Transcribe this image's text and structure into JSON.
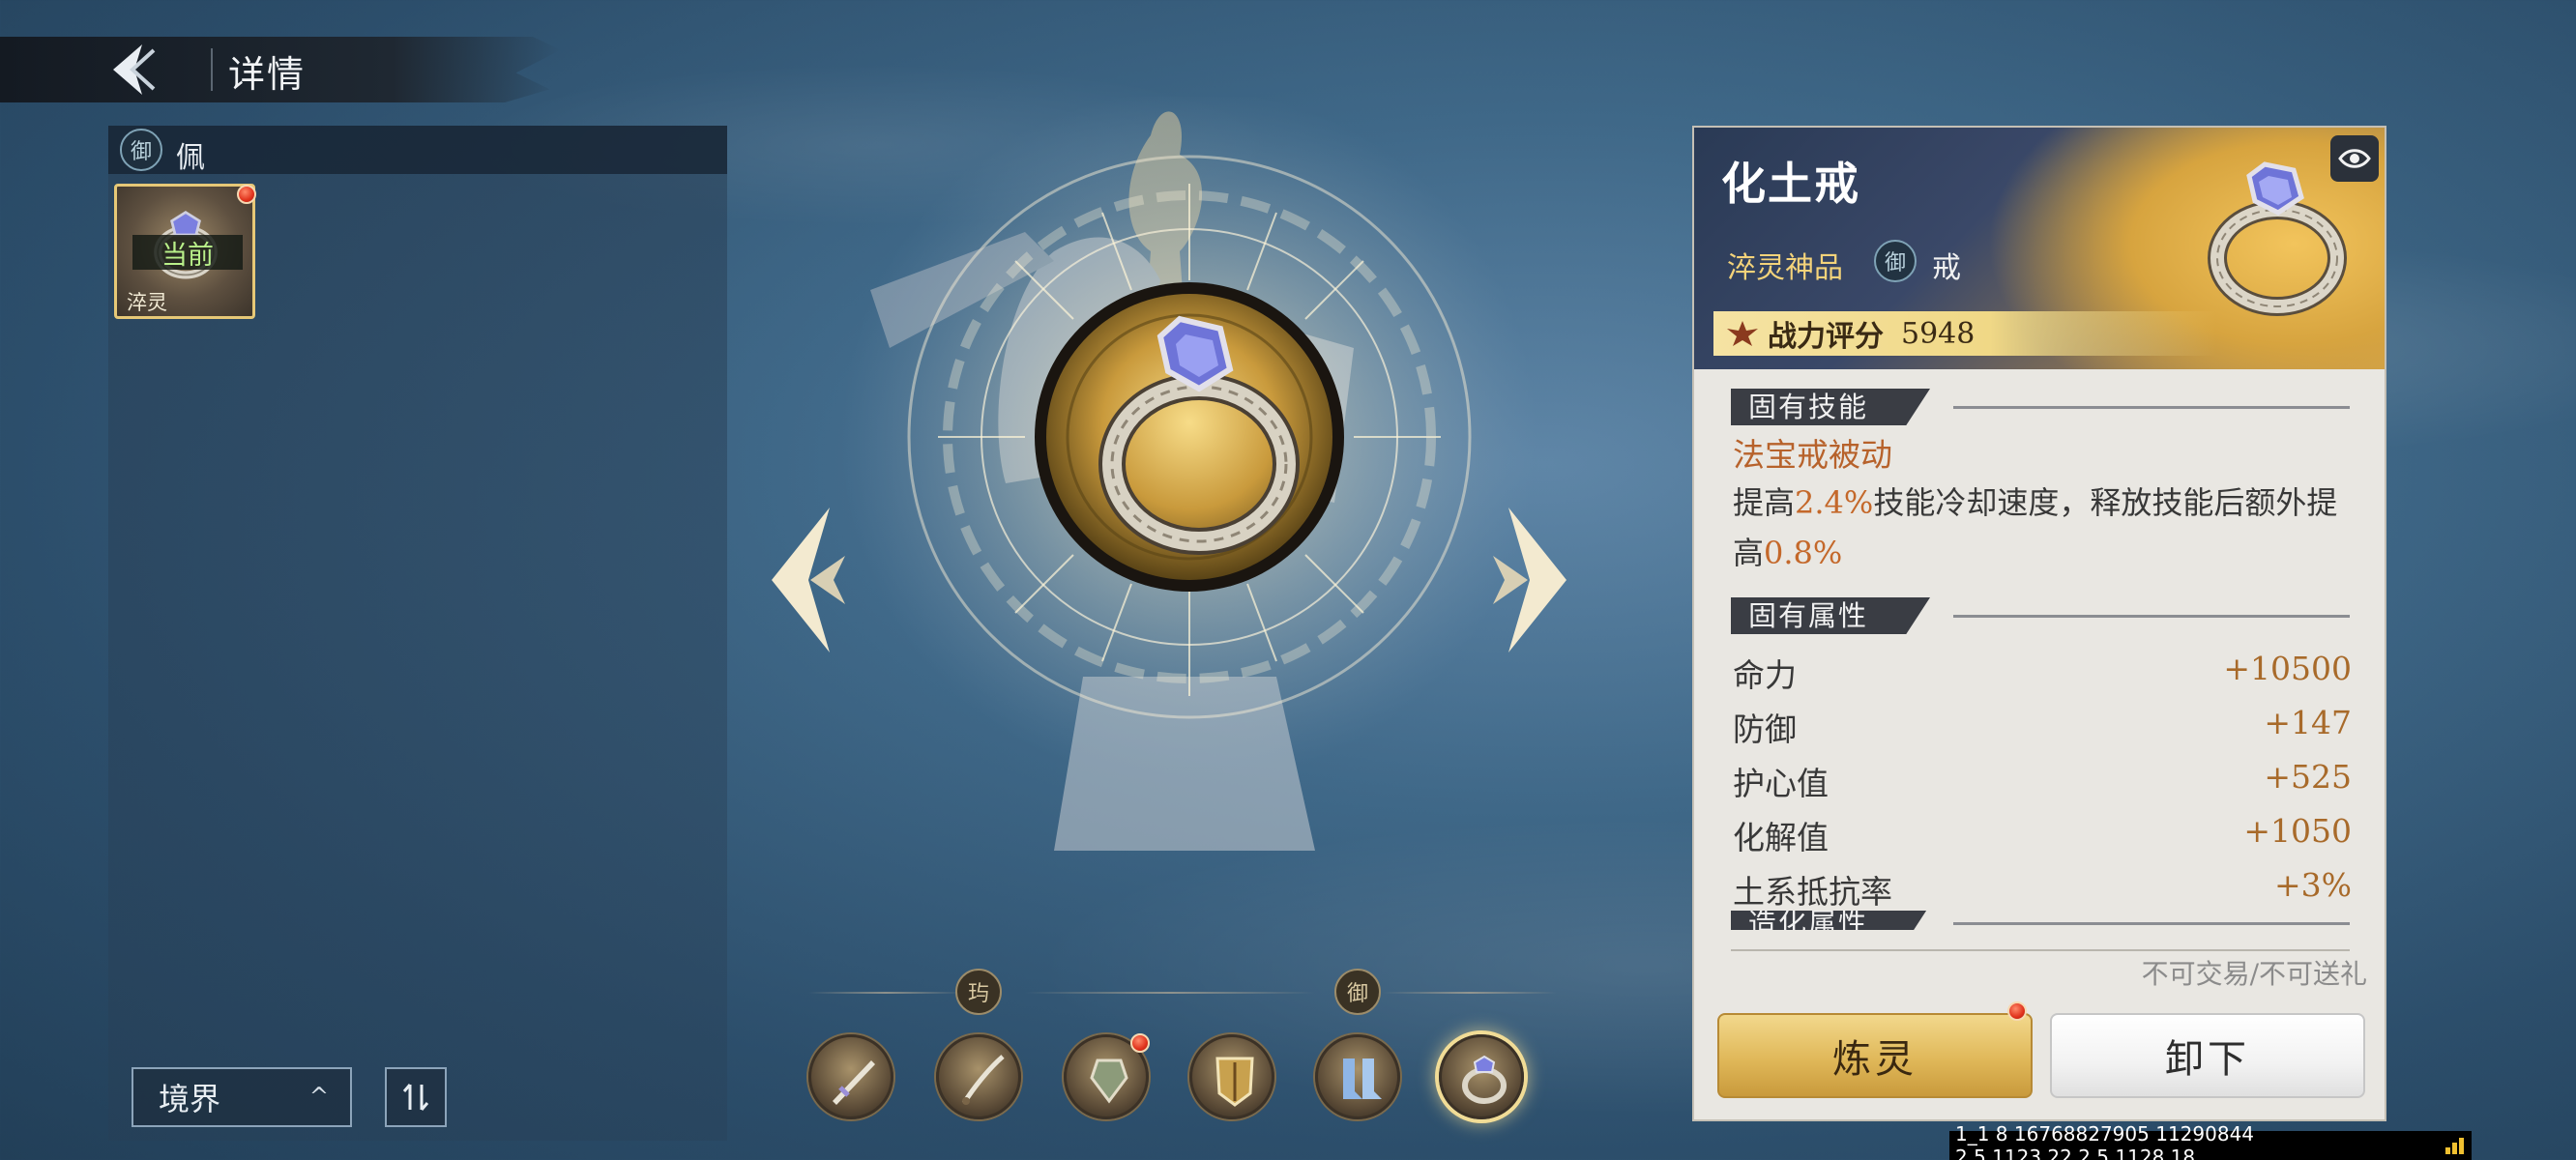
{
  "header": {
    "title": "详情"
  },
  "left_panel": {
    "tab_emblem": "御",
    "tab_label": "佩",
    "item": {
      "status": "当前",
      "tag": "淬灵",
      "icon": "ring-icon",
      "has_alert": true
    }
  },
  "bottom_left": {
    "realm_label": "境界",
    "realm_caret": "^",
    "sort_icon": "sort-swap-icon"
  },
  "equip_groups": [
    {
      "emblem": "玙"
    },
    {
      "emblem": "御"
    }
  ],
  "equip_slots": [
    {
      "icon": "sword-icon",
      "active": false,
      "alert": false
    },
    {
      "icon": "blade-icon",
      "active": false,
      "alert": false
    },
    {
      "icon": "pendant-icon",
      "active": false,
      "alert": true
    },
    {
      "icon": "armor-icon",
      "active": false,
      "alert": false
    },
    {
      "icon": "boots-icon",
      "active": false,
      "alert": false
    },
    {
      "icon": "ring-icon",
      "active": true,
      "alert": false
    }
  ],
  "card": {
    "name": "化土戒",
    "grade": "淬灵神品",
    "emblem": "御",
    "slot_type": "戒",
    "score_label": "战力评分",
    "score_value": "5948",
    "sections": {
      "innate_skill": "固有技能",
      "innate_attr": "固有属性",
      "forge_attr": "造化属性"
    },
    "skill": {
      "name": "法宝戒被动",
      "desc_pre": "提高",
      "desc_val1": "2.4%",
      "desc_mid": "技能冷却速度，释放技能后额外提高",
      "desc_val2": "0.8%"
    },
    "stats": [
      {
        "name": "命力",
        "value": "+10500"
      },
      {
        "name": "防御",
        "value": "+147"
      },
      {
        "name": "护心值",
        "value": "+525"
      },
      {
        "name": "化解值",
        "value": "+1050"
      },
      {
        "name": "土系抵抗率",
        "value": "+3%"
      }
    ],
    "trade_note": "不可交易/不可送礼",
    "btn_refine": "炼灵",
    "btn_unequip": "卸下"
  },
  "debug_text": "1_1 8 16768827905 11290844 2.5.1123.22.2.5.1128.18",
  "colors": {
    "gold": "#e0b859",
    "highlight": "#c4682a",
    "alert": "#e0321c"
  }
}
